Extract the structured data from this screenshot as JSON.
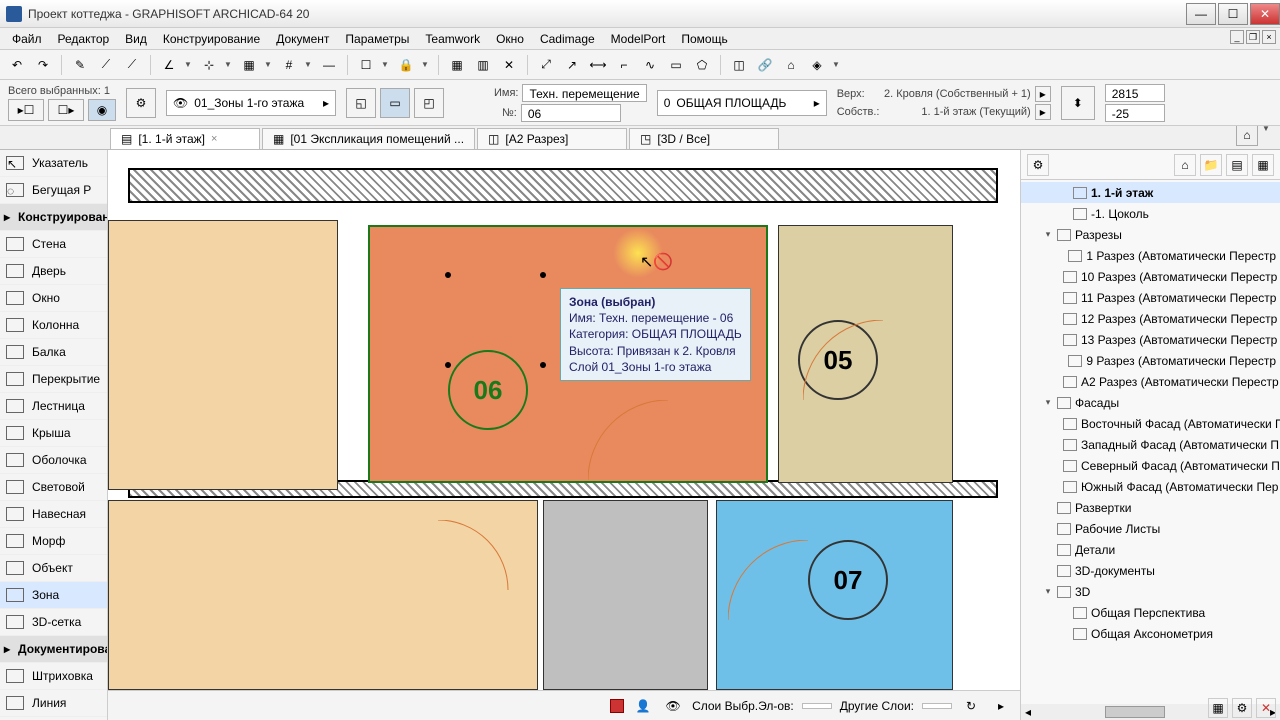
{
  "title": "Проект коттеджа - GRAPHISOFT ARCHICAD-64 20",
  "menu": [
    "Файл",
    "Редактор",
    "Вид",
    "Конструирование",
    "Документ",
    "Параметры",
    "Teamwork",
    "Окно",
    "Cadimage",
    "ModelPort",
    "Помощь"
  ],
  "selection_info": "Всего выбранных: 1",
  "layer_selector": "01_Зоны 1-го этажа",
  "props": {
    "name_label": "Имя:",
    "name_value": "Техн. перемещение",
    "num_label": "№:",
    "num_value": "06",
    "cat_label_num": "0",
    "cat_value": "ОБЩАЯ ПЛОЩАДЬ",
    "top_label": "Верх:",
    "top_value": "2. Кровля (Собственный + 1)",
    "bottom_label": "Собств.:",
    "bottom_value": "1. 1-й этаж (Текущий)",
    "val1": "2815",
    "val2": "-25"
  },
  "tabs": [
    {
      "label": "[1. 1-й этаж]",
      "active": true,
      "closable": true
    },
    {
      "label": "[01 Экспликация помещений ...",
      "active": false
    },
    {
      "label": "[А2 Разрез]",
      "active": false
    },
    {
      "label": "[3D / Все]",
      "active": false
    }
  ],
  "tools": {
    "header1": "Конструирование",
    "header2": "Документирование",
    "items": [
      "Указатель",
      "Бегущая Р",
      "Стена",
      "Дверь",
      "Окно",
      "Колонна",
      "Балка",
      "Перекрытие",
      "Лестница",
      "Крыша",
      "Оболочка",
      "Световой",
      "Навесная",
      "Морф",
      "Объект",
      "Зона",
      "3D-сетка",
      "Штриховка",
      "Линия"
    ]
  },
  "zones": {
    "z05": "05",
    "z06": "06",
    "z07": "07"
  },
  "tooltip": {
    "l1": "Зона (выбран)",
    "l2": "Имя: Техн. перемещение - 06",
    "l3": "Категория: ОБЩАЯ ПЛОЩАДЬ",
    "l4": "Высота: Привязан к 2. Кровля",
    "l5": "Слой 01_Зоны 1-го этажа"
  },
  "navigator": {
    "items": [
      {
        "label": "1. 1-й этаж",
        "indent": 2,
        "sel": true
      },
      {
        "label": "-1. Цоколь",
        "indent": 2
      },
      {
        "label": "Разрезы",
        "indent": 1,
        "toggle": "▾"
      },
      {
        "label": "1 Разрез (Автоматически Перестр",
        "indent": 2
      },
      {
        "label": "10 Разрез (Автоматически Перестр",
        "indent": 2
      },
      {
        "label": "11 Разрез (Автоматически Перестр",
        "indent": 2
      },
      {
        "label": "12 Разрез (Автоматически Перестр",
        "indent": 2
      },
      {
        "label": "13 Разрез (Автоматически Перестр",
        "indent": 2
      },
      {
        "label": "9 Разрез (Автоматически Перестр",
        "indent": 2
      },
      {
        "label": "А2 Разрез (Автоматически Перестр",
        "indent": 2
      },
      {
        "label": "Фасады",
        "indent": 1,
        "toggle": "▾"
      },
      {
        "label": "Восточный Фасад (Автоматически П",
        "indent": 2
      },
      {
        "label": "Западный Фасад (Автоматически П",
        "indent": 2
      },
      {
        "label": "Северный Фасад (Автоматически П",
        "indent": 2
      },
      {
        "label": "Южный Фасад (Автоматически Пер",
        "indent": 2
      },
      {
        "label": "Развертки",
        "indent": 1
      },
      {
        "label": "Рабочие Листы",
        "indent": 1
      },
      {
        "label": "Детали",
        "indent": 1
      },
      {
        "label": "3D-документы",
        "indent": 1
      },
      {
        "label": "3D",
        "indent": 1,
        "toggle": "▾"
      },
      {
        "label": "Общая Перспектива",
        "indent": 2
      },
      {
        "label": "Общая Аксонометрия",
        "indent": 2
      }
    ]
  },
  "status": {
    "layers_label": "Слои Выбр.Эл-ов:",
    "other_label": "Другие Слои:"
  }
}
